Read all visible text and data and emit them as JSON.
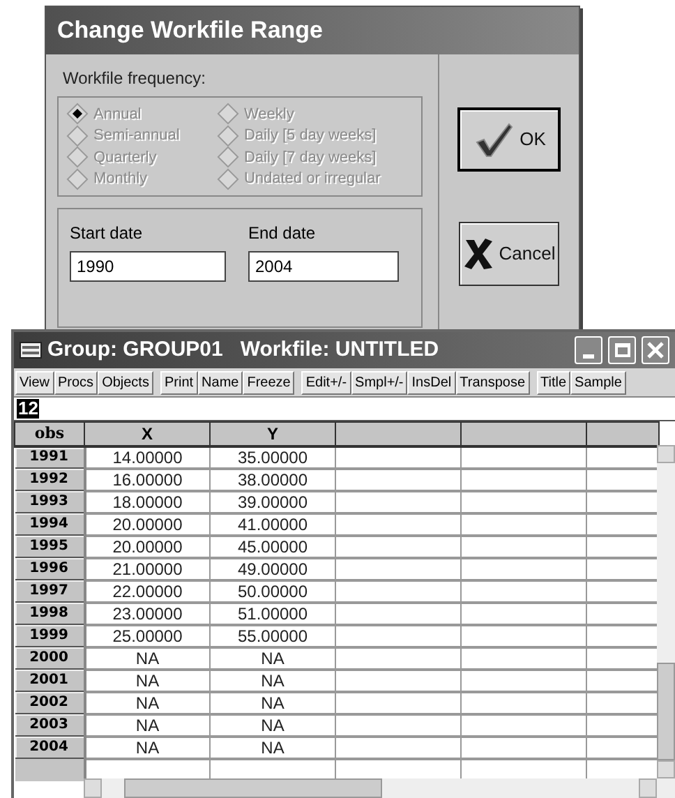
{
  "dialog": {
    "title": "Change Workfile Range",
    "frequency_label": "Workfile frequency:",
    "frequencies": [
      {
        "label": "Annual",
        "selected": true,
        "disabled": true
      },
      {
        "label": "Semi-annual",
        "selected": false,
        "disabled": true
      },
      {
        "label": "Quarterly",
        "selected": false,
        "disabled": true
      },
      {
        "label": "Monthly",
        "selected": false,
        "disabled": true
      },
      {
        "label": "Weekly",
        "selected": false,
        "disabled": true
      },
      {
        "label": "Daily [5 day weeks]",
        "selected": false,
        "disabled": true
      },
      {
        "label": "Daily [7 day weeks]",
        "selected": false,
        "disabled": true
      },
      {
        "label": "Undated or irregular",
        "selected": false,
        "disabled": true
      }
    ],
    "start_label": "Start date",
    "start_value": "1990",
    "end_label": "End date",
    "end_value": "2004",
    "buttons": [
      {
        "kind": "ok",
        "label": "OK"
      },
      {
        "kind": "cancel",
        "label": "Cancel"
      }
    ]
  },
  "group_window": {
    "title": "Group: GROUP01   Workfile: UNTITLED",
    "toolbar": [
      [
        "View",
        "Procs",
        "Objects"
      ],
      [
        "Print",
        "Name",
        "Freeze"
      ],
      [
        "Edit+/-",
        "Smpl+/-",
        "InsDel",
        "Transpose"
      ],
      [
        "Title",
        "Sample"
      ]
    ],
    "edit_value": "12",
    "columns": [
      "obs",
      "X",
      "Y"
    ],
    "rows": [
      {
        "cells": [
          "1991",
          "14.00000",
          "35.00000"
        ]
      },
      {
        "cells": [
          "1992",
          "16.00000",
          "38.00000"
        ]
      },
      {
        "cells": [
          "1993",
          "18.00000",
          "39.00000"
        ]
      },
      {
        "cells": [
          "1994",
          "20.00000",
          "41.00000"
        ]
      },
      {
        "cells": [
          "1995",
          "20.00000",
          "45.00000"
        ]
      },
      {
        "cells": [
          "1996",
          "21.00000",
          "49.00000"
        ]
      },
      {
        "cells": [
          "1997",
          "22.00000",
          "50.00000"
        ]
      },
      {
        "cells": [
          "1998",
          "23.00000",
          "51.00000"
        ]
      },
      {
        "cells": [
          "1999",
          "25.00000",
          "55.00000"
        ]
      },
      {
        "cells": [
          "2000",
          "NA",
          "NA"
        ]
      },
      {
        "cells": [
          "2001",
          "NA",
          "NA"
        ]
      },
      {
        "cells": [
          "2002",
          "NA",
          "NA"
        ]
      },
      {
        "cells": [
          "2003",
          "NA",
          "NA"
        ]
      },
      {
        "cells": [
          "2004",
          "NA",
          "NA"
        ]
      }
    ]
  }
}
